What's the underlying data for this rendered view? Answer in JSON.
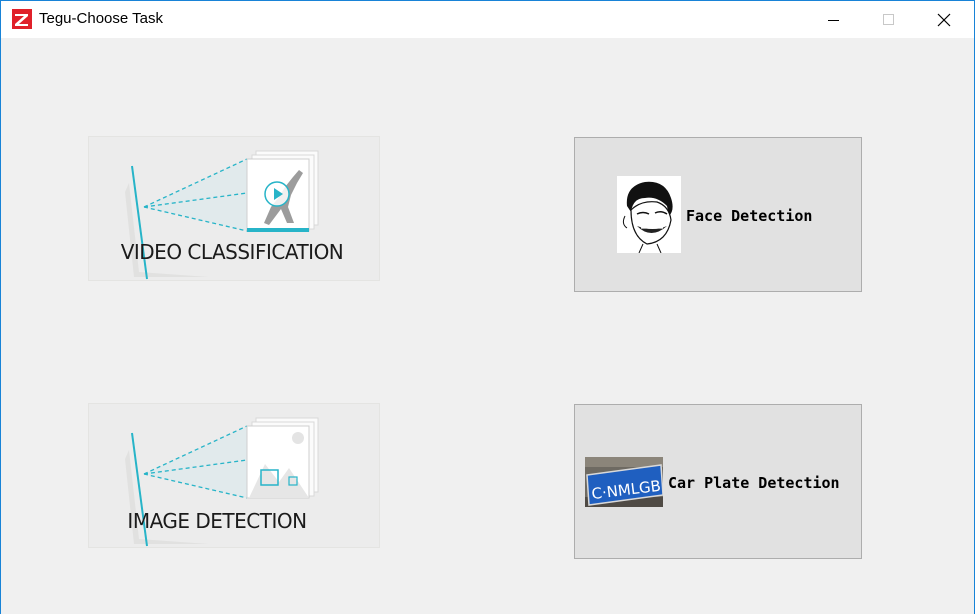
{
  "window": {
    "title": "Tegu-Choose Task",
    "controls": {
      "minimize": "minimize",
      "maximize": "maximize",
      "close": "close"
    },
    "accent": "#1883d7"
  },
  "tasks": {
    "video": {
      "label": "VIDEO CLASSIFICATION",
      "icon": "video-play-icon"
    },
    "image": {
      "label": "IMAGE DETECTION",
      "icon": "image-icon"
    },
    "face": {
      "label": "Face Detection",
      "icon": "face-meme-image"
    },
    "plate": {
      "label": "Car Plate Detection",
      "icon": "license-plate-image",
      "plate_text": "C·NMLGB"
    }
  },
  "colors": {
    "teal": "#27b4c8",
    "button_bg": "#e1e1e1",
    "button_border": "#adadad",
    "plate_blue": "#1f5fc0",
    "logo_red": "#e0202a"
  }
}
